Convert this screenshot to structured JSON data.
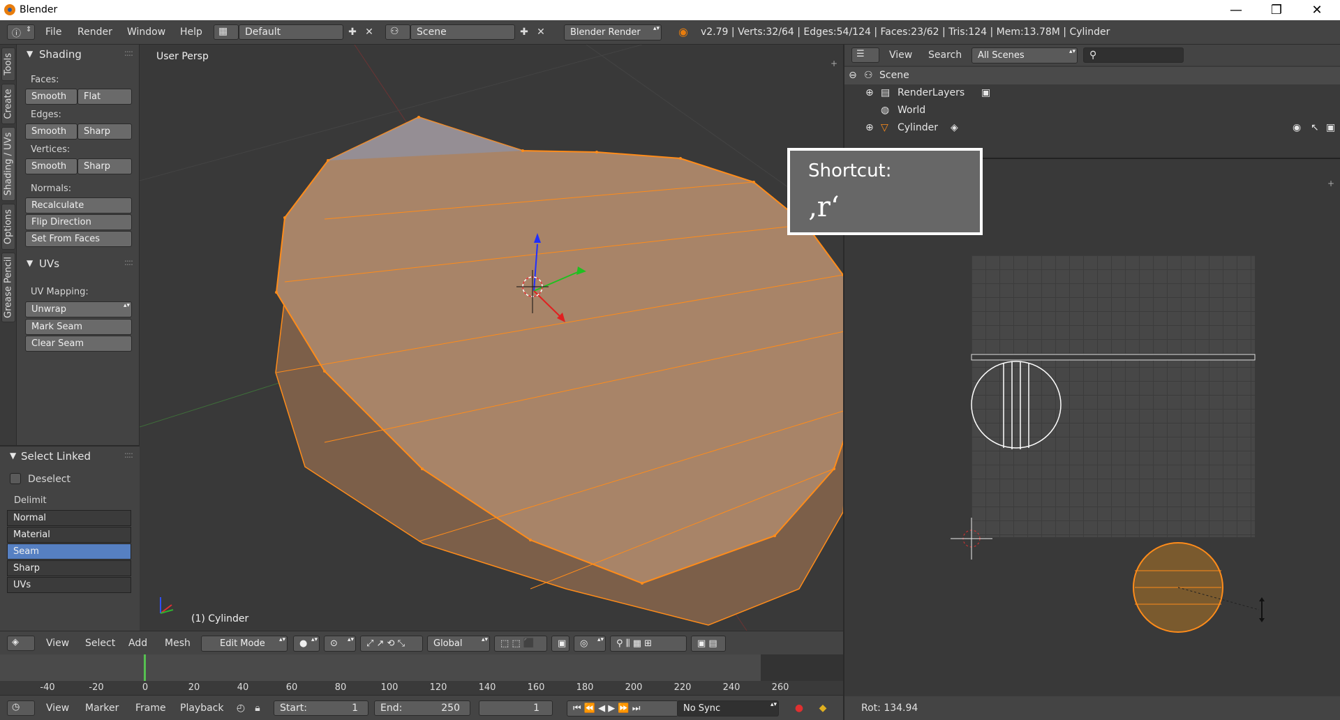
{
  "window": {
    "title": "Blender",
    "minimize": "—",
    "maximize": "❐",
    "close": "✕"
  },
  "info_header": {
    "menus": [
      "File",
      "Render",
      "Window",
      "Help"
    ],
    "layout": "Default",
    "scene": "Scene",
    "engine": "Blender Render",
    "stats": "v2.79 | Verts:32/64 | Edges:54/124 | Faces:23/62 | Tris:124 | Mem:13.78M | Cylinder"
  },
  "tool_tabs": [
    "Tools",
    "Create",
    "Shading / UVs",
    "Options",
    "Grease Pencil"
  ],
  "shading_panel": {
    "title": "Shading",
    "faces_label": "Faces:",
    "edges_label": "Edges:",
    "vertices_label": "Vertices:",
    "normals_label": "Normals:",
    "smooth": "Smooth",
    "flat": "Flat",
    "sharp": "Sharp",
    "recalculate": "Recalculate",
    "flip_direction": "Flip Direction",
    "set_from_faces": "Set From Faces"
  },
  "uvs_panel": {
    "title": "UVs",
    "uv_mapping_label": "UV Mapping:",
    "unwrap": "Unwrap",
    "mark_seam": "Mark Seam",
    "clear_seam": "Clear Seam"
  },
  "select_linked": {
    "title": "Select Linked",
    "deselect": "Deselect",
    "delimit_label": "Delimit",
    "options": [
      "Normal",
      "Material",
      "Seam",
      "Sharp",
      "UVs"
    ],
    "active": "Seam"
  },
  "viewport": {
    "view_label": "User Persp",
    "object_label": "(1) Cylinder"
  },
  "viewport_header": {
    "menus": [
      "View",
      "Select",
      "Add",
      "Mesh"
    ],
    "mode": "Edit Mode",
    "orientation": "Global"
  },
  "timeline": {
    "ticks": [
      "-40",
      "-20",
      "0",
      "20",
      "40",
      "60",
      "80",
      "100",
      "120",
      "140",
      "160",
      "180",
      "200",
      "220",
      "240",
      "260"
    ],
    "menus": [
      "View",
      "Marker",
      "Frame",
      "Playback"
    ],
    "start_label": "Start:",
    "start": "1",
    "end_label": "End:",
    "end": "250",
    "current_frame": "1",
    "sync": "No Sync"
  },
  "outliner": {
    "menus": [
      "View",
      "Search"
    ],
    "filter": "All Scenes",
    "items": [
      "Scene",
      "RenderLayers",
      "World",
      "Cylinder"
    ]
  },
  "shortcut": {
    "title": "Shortcut:",
    "key": "‚r‘"
  },
  "uv_status": "Rot: 134.94",
  "colors": {
    "accent": "#5680c2",
    "selection": "#ff8c1a",
    "mesh_fill": "#a88468"
  }
}
